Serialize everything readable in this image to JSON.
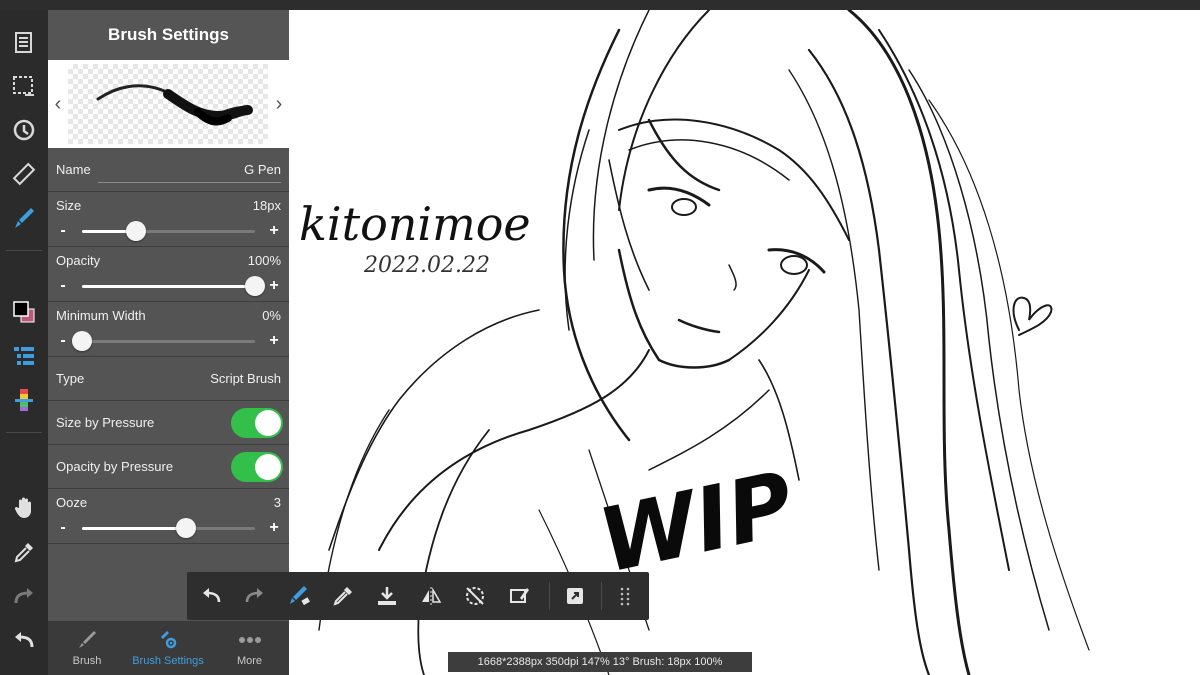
{
  "panel": {
    "title": "Brush Settings",
    "name_label": "Name",
    "name_value": "G Pen",
    "size_label": "Size",
    "size_value": "18px",
    "size_fraction": 0.31,
    "opacity_label": "Opacity",
    "opacity_value": "100%",
    "opacity_fraction": 1.0,
    "minwidth_label": "Minimum Width",
    "minwidth_value": "0%",
    "minwidth_fraction": 0.0,
    "type_label": "Type",
    "type_value": "Script Brush",
    "size_pressure_label": "Size by Pressure",
    "size_pressure_on": true,
    "opacity_pressure_label": "Opacity by Pressure",
    "opacity_pressure_on": true,
    "ooze_label": "Ooze",
    "ooze_value": "3",
    "ooze_fraction": 0.6,
    "minus": "-",
    "plus": "+",
    "prev_arrow": "‹",
    "next_arrow": "›"
  },
  "tabs": {
    "brush": "Brush",
    "brush_settings": "Brush Settings",
    "more": "More"
  },
  "status": "1668*2388px 350dpi 147% 13° Brush: 18px 100%",
  "canvas_text": {
    "signature": "kitonimoe",
    "date": "2022.02.22",
    "wip": "WIP"
  },
  "colors": {
    "accent": "#3f9ee0",
    "toggle_on": "#33c04a",
    "primary_color": "#000000",
    "secondary_color": "#b85a7a"
  },
  "icons": {
    "left_toolbar": [
      "layers-icon",
      "selection-icon",
      "transform-icon",
      "ruler-icon",
      "brush-icon",
      "color-swatch-icon",
      "layer-list-icon",
      "gradient-icon",
      "hand-icon",
      "eyedropper-icon",
      "redo-icon",
      "undo-icon"
    ],
    "action_bar": [
      "undo-icon",
      "redo-icon",
      "brush-eraser-icon",
      "eyedropper-icon",
      "fill-icon",
      "flip-icon",
      "snap-off-icon",
      "eraser-icon",
      "fullscreen-icon",
      "grid-dots-icon"
    ]
  }
}
